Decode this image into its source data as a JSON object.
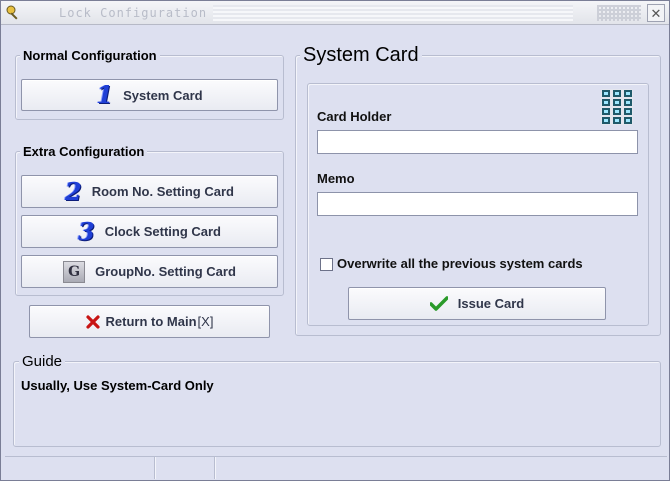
{
  "window": {
    "title": "Lock Configuration",
    "close_symbol": "✕"
  },
  "normal_config": {
    "legend": "Normal Configuration",
    "system_card_button": {
      "label": "System Card",
      "icon": "number-1-icon",
      "icon_glyph": "1"
    }
  },
  "extra_config": {
    "legend": "Extra Configuration",
    "buttons": [
      {
        "label": "Room No. Setting Card",
        "icon": "number-2-icon",
        "icon_glyph": "2"
      },
      {
        "label": "Clock Setting Card",
        "icon": "number-3-icon",
        "icon_glyph": "3"
      },
      {
        "label": "GroupNo. Setting Card",
        "icon": "letter-g-icon",
        "icon_glyph": "G"
      }
    ]
  },
  "return_button": {
    "label": "Return to Main",
    "icon": "red-x-icon",
    "suffix": "[X]"
  },
  "system_card_panel": {
    "legend": "System Card",
    "icon": "keypad-icon",
    "card_holder": {
      "label": "Card Holder",
      "value": "",
      "placeholder": ""
    },
    "memo": {
      "label": "Memo",
      "value": "",
      "placeholder": ""
    },
    "overwrite_checkbox": {
      "label": "Overwrite all the previous system cards",
      "checked": false
    },
    "issue_button": {
      "label": "Issue Card",
      "icon": "green-check-icon"
    }
  },
  "guide": {
    "legend": "Guide",
    "text": "Usually, Use System-Card Only"
  },
  "colors": {
    "window_bg": "#dde0f0",
    "number_icon_blue": "#1f3fd6",
    "x_icon_red": "#c81414",
    "check_icon_green": "#2a9a2a"
  }
}
